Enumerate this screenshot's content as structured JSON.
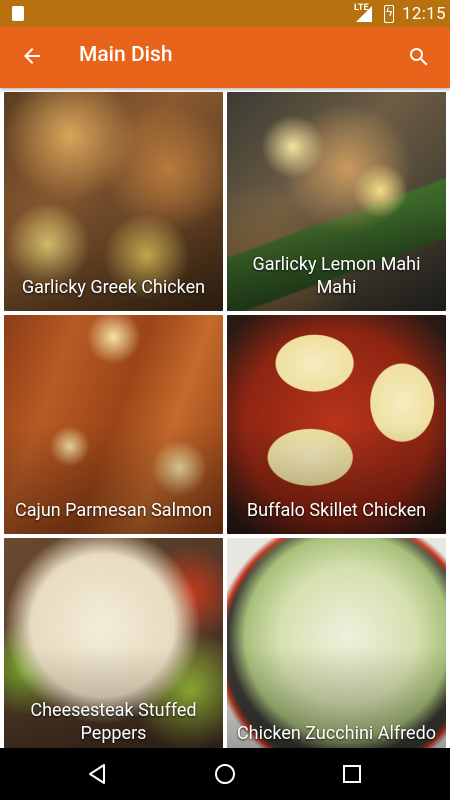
{
  "status_bar": {
    "time": "12:15",
    "network": "LTE"
  },
  "app_bar": {
    "title": "Main Dish"
  },
  "recipes": [
    {
      "name": "Garlicky Greek Chicken"
    },
    {
      "name": "Garlicky Lemon Mahi Mahi"
    },
    {
      "name": "Cajun Parmesan Salmon"
    },
    {
      "name": "Buffalo Skillet Chicken"
    },
    {
      "name": "Cheesesteak Stuffed Peppers"
    },
    {
      "name": "Chicken Zucchini Alfredo"
    }
  ],
  "colors": {
    "status_bar": "#b8710f",
    "app_bar": "#e8641a"
  },
  "icons": {
    "back": "arrow-back-icon",
    "search": "search-icon"
  }
}
